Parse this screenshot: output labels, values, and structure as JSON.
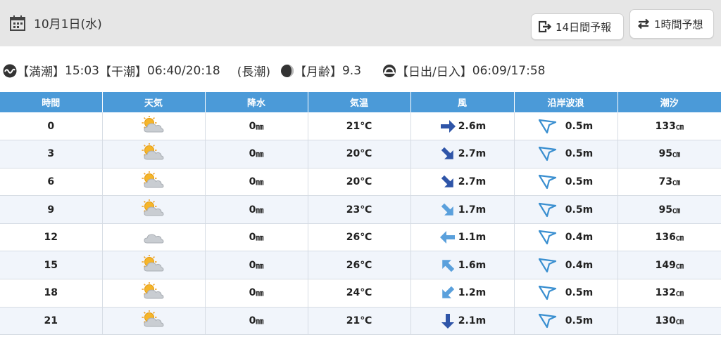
{
  "header": {
    "date": "10月1日(水)",
    "btn_14day": "14日間予報",
    "btn_1hour": "1時間予想"
  },
  "tide": {
    "high_label": "【満潮】",
    "high_value": "15:03",
    "low_label": "【干潮】",
    "low_value": "06:40/20:18",
    "tide_type": "(長潮)",
    "moon_label": "【月齢】",
    "moon_value": "9.3",
    "sun_label": "【日出/日入】",
    "sun_value": "06:09/17:58"
  },
  "table": {
    "headers": [
      "時間",
      "天気",
      "降水",
      "気温",
      "風",
      "沿岸波浪",
      "潮汐"
    ],
    "rows": [
      {
        "time": "0",
        "weather": "sun-behind-cloud-icon",
        "precip": "0",
        "temp": "21℃",
        "wind_dir": "east",
        "wind": "2.6m",
        "wave": "0.5m",
        "tide": "133"
      },
      {
        "time": "3",
        "weather": "sun-behind-cloud-icon",
        "precip": "0",
        "temp": "20℃",
        "wind_dir": "southeast",
        "wind": "2.7m",
        "wave": "0.5m",
        "tide": "95"
      },
      {
        "time": "6",
        "weather": "sun-behind-cloud-icon",
        "precip": "0",
        "temp": "20℃",
        "wind_dir": "southeast",
        "wind": "2.7m",
        "wave": "0.5m",
        "tide": "73"
      },
      {
        "time": "9",
        "weather": "sun-behind-cloud-icon",
        "precip": "0",
        "temp": "23℃",
        "wind_dir": "southeast",
        "wind": "1.7m",
        "wave": "0.5m",
        "tide": "95"
      },
      {
        "time": "12",
        "weather": "cloud-icon",
        "precip": "0",
        "temp": "26℃",
        "wind_dir": "west",
        "wind": "1.1m",
        "wave": "0.4m",
        "tide": "136"
      },
      {
        "time": "15",
        "weather": "sun-behind-cloud-icon",
        "precip": "0",
        "temp": "26℃",
        "wind_dir": "northwest",
        "wind": "1.6m",
        "wave": "0.4m",
        "tide": "149"
      },
      {
        "time": "18",
        "weather": "sun-behind-cloud-icon",
        "precip": "0",
        "temp": "24℃",
        "wind_dir": "southwest",
        "wind": "1.2m",
        "wave": "0.5m",
        "tide": "132"
      },
      {
        "time": "21",
        "weather": "sun-behind-cloud-icon",
        "precip": "0",
        "temp": "21℃",
        "wind_dir": "south",
        "wind": "2.1m",
        "wave": "0.5m",
        "tide": "130"
      }
    ],
    "precip_unit": "㎜",
    "tide_unit": "㎝"
  },
  "colors": {
    "header_bg": "#4b9ad8",
    "wind_arrow_strong": "#2f55a8",
    "wind_arrow_light": "#5aa0dc",
    "wave_icon": "#3a8fd0"
  }
}
